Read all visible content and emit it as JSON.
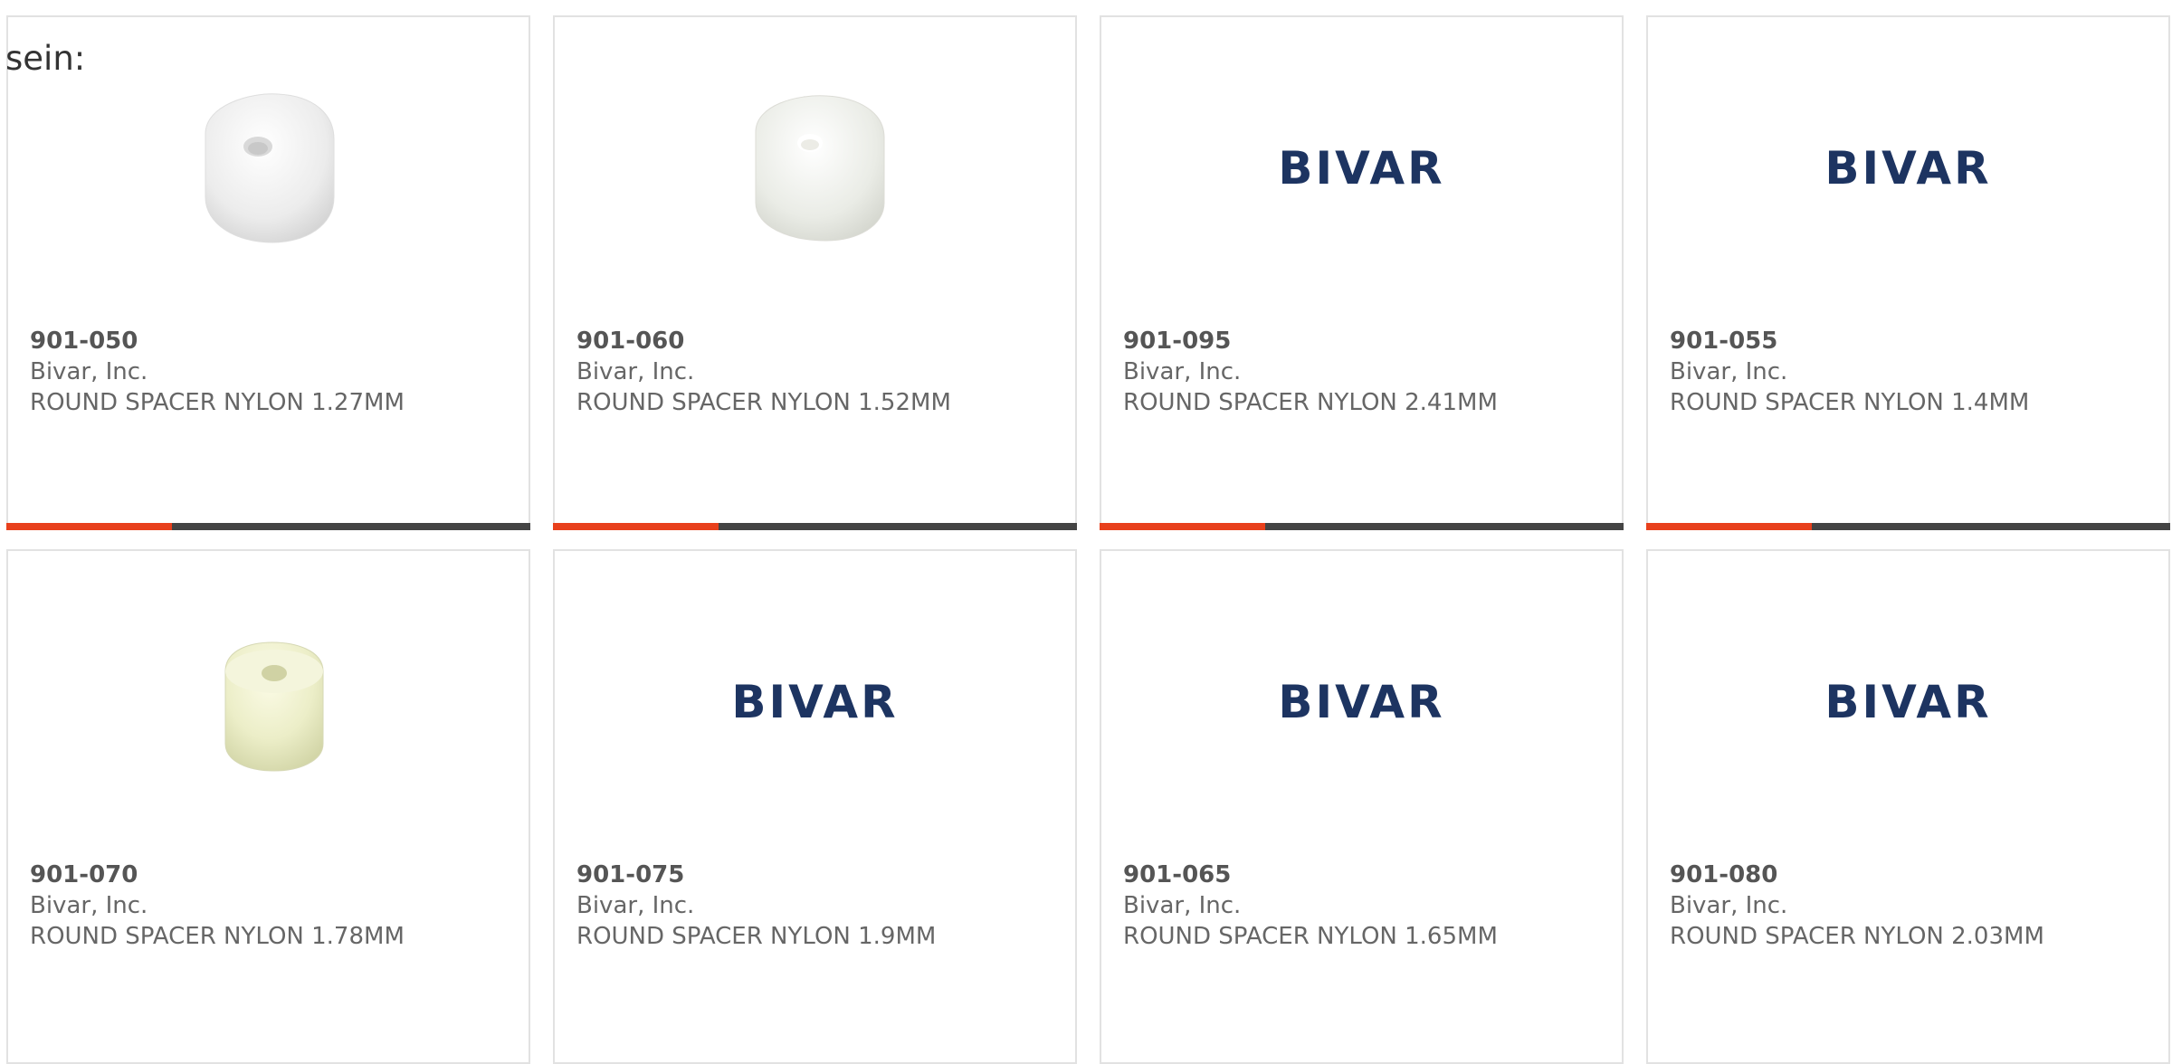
{
  "page": {
    "stray_text": "sein:"
  },
  "theme": {
    "accent_color": "#e8401c",
    "bar_color": "#444444",
    "logo_color": "#1d3461"
  },
  "products": [
    {
      "part_number": "901-050",
      "manufacturer": "Bivar, Inc.",
      "description": "ROUND SPACER NYLON 1.27MM",
      "image": "white-spacer-photo"
    },
    {
      "part_number": "901-060",
      "manufacturer": "Bivar, Inc.",
      "description": "ROUND SPACER NYLON 1.52MM",
      "image": "white-spacer-photo"
    },
    {
      "part_number": "901-095",
      "manufacturer": "Bivar, Inc.",
      "description": "ROUND SPACER NYLON 2.41MM",
      "image": "bivar-logo",
      "logo_text": "BIVAR"
    },
    {
      "part_number": "901-055",
      "manufacturer": "Bivar, Inc.",
      "description": "ROUND SPACER NYLON 1.4MM",
      "image": "bivar-logo",
      "logo_text": "BIVAR"
    },
    {
      "part_number": "901-070",
      "manufacturer": "Bivar, Inc.",
      "description": "ROUND SPACER NYLON 1.78MM",
      "image": "cream-spacer-photo"
    },
    {
      "part_number": "901-075",
      "manufacturer": "Bivar, Inc.",
      "description": "ROUND SPACER NYLON 1.9MM",
      "image": "bivar-logo",
      "logo_text": "BIVAR"
    },
    {
      "part_number": "901-065",
      "manufacturer": "Bivar, Inc.",
      "description": "ROUND SPACER NYLON 1.65MM",
      "image": "bivar-logo",
      "logo_text": "BIVAR"
    },
    {
      "part_number": "901-080",
      "manufacturer": "Bivar, Inc.",
      "description": "ROUND SPACER NYLON 2.03MM",
      "image": "bivar-logo",
      "logo_text": "BIVAR"
    }
  ]
}
